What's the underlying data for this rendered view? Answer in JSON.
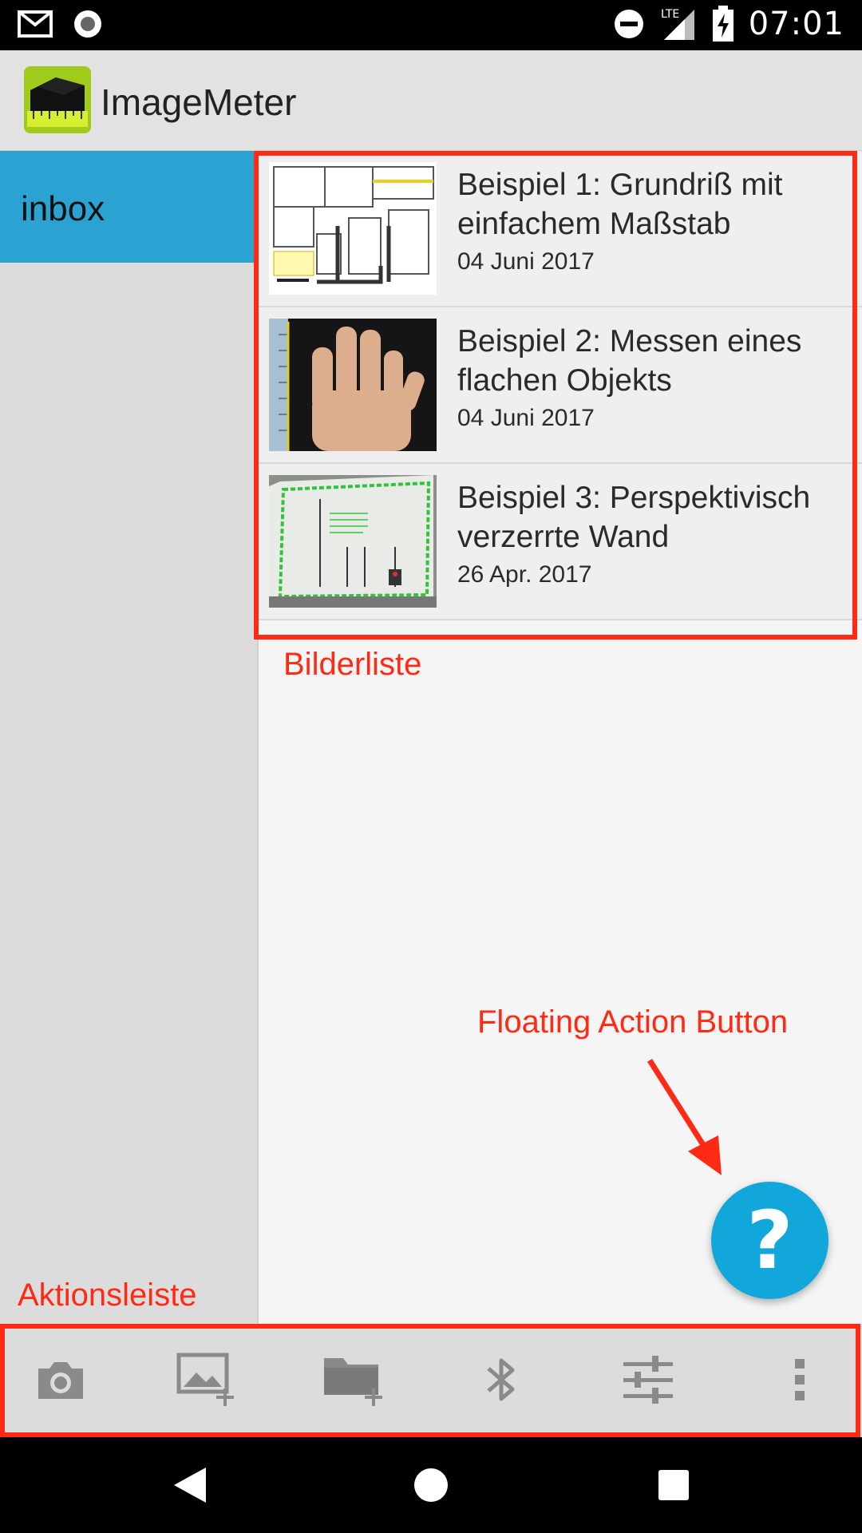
{
  "status_bar": {
    "time": "07:01",
    "network": "LTE",
    "icons": [
      "gmail-icon",
      "record-icon",
      "do-not-disturb-icon",
      "signal-icon",
      "battery-charging-icon"
    ]
  },
  "app": {
    "title": "ImageMeter",
    "logo_icon": "imagemeter-logo",
    "accent_color": "#2aa3d3"
  },
  "sidebar": {
    "items": [
      {
        "label": "inbox",
        "selected": true
      }
    ]
  },
  "images": [
    {
      "title": "Beispiel 1: Grundriß mit einfachem Maßstab",
      "date": "04 Juni 2017",
      "thumbnail": "floorplan-thumbnail"
    },
    {
      "title": "Beispiel 2: Messen eines flachen Objekts",
      "date": "04 Juni 2017",
      "thumbnail": "hand-thumbnail"
    },
    {
      "title": "Beispiel 3: Perspektivisch verzerrte Wand",
      "date": "26 Apr. 2017",
      "thumbnail": "wall-thumbnail"
    }
  ],
  "annotations": {
    "image_list": "Bilderliste",
    "fab": "Floating Action Button",
    "action_bar": "Aktionsleiste",
    "color": "#ff2a14"
  },
  "fab": {
    "label": "?",
    "icon": "help-icon",
    "color": "#12a7da"
  },
  "action_bar": {
    "buttons": [
      "camera-icon",
      "add-image-icon",
      "add-folder-icon",
      "bluetooth-icon",
      "settings-sliders-icon",
      "more-vert-icon"
    ]
  },
  "nav_bar": {
    "buttons": [
      "back-icon",
      "home-icon",
      "recents-icon"
    ]
  }
}
